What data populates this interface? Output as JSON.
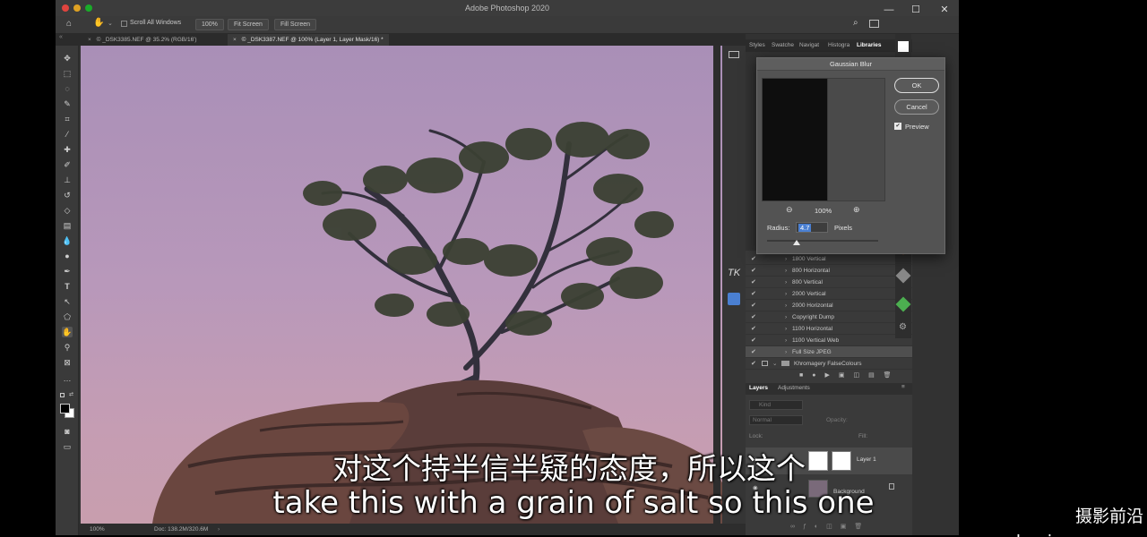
{
  "app": {
    "title": "Adobe Photoshop 2020"
  },
  "window_controls": {
    "minimize": "—",
    "maximize": "☐",
    "close": "✕"
  },
  "options_bar": {
    "scroll_all": "Scroll All Windows",
    "zoom": "100%",
    "fit_screen": "Fit Screen",
    "fill_screen": "Fill Screen"
  },
  "tabs": [
    {
      "label": "© _DSK3385.NEF @ 35.2% (RGB/16')"
    },
    {
      "label": "© _DSK3387.NEF @ 100% (Layer 1, Layer Mask/16) *"
    }
  ],
  "status": {
    "zoom": "100%",
    "doc": "Doc: 138.2M/320.6M"
  },
  "panel_tabs": [
    "Styles",
    "Swatche",
    "Navigat",
    "Histogra",
    "Libraries"
  ],
  "dialog": {
    "title": "Gaussian Blur",
    "ok": "OK",
    "cancel": "Cancel",
    "preview": "Preview",
    "zoom": "100%",
    "radius_label": "Radius:",
    "radius_value": "4.7",
    "unit": "Pixels"
  },
  "side_glyphs": {
    "tk": "TK"
  },
  "actions": [
    {
      "label": "1800 Vertical"
    },
    {
      "label": "800 Horizontal"
    },
    {
      "label": "800 Vertical"
    },
    {
      "label": "2000 Vertical"
    },
    {
      "label": "2000 Horizontal"
    },
    {
      "label": "Copyright Dump"
    },
    {
      "label": "1100 Horizontal"
    },
    {
      "label": "1100 Vertical Web"
    },
    {
      "label": "Full Size JPEG"
    },
    {
      "label": "Khromagery FalseColours"
    }
  ],
  "layers_panel": {
    "tabs": [
      "Layers",
      "Adjustments"
    ],
    "kind": "Kind",
    "blend": "Normal",
    "opacity": "Opacity:",
    "lock": "Lock:",
    "fill": "Fill:",
    "layer1": "Layer 1",
    "background": "Background"
  },
  "subtitles": {
    "chinese": "对这个持半信半疑的态度，所以这个",
    "english": "take this with a grain of salt so this one"
  },
  "watermark": "摄影前沿 sheyingzyz.com",
  "colors": {
    "canvas_sky": "#b898ba",
    "ui_dark": "#323232",
    "accent": "#4a7fd1"
  }
}
